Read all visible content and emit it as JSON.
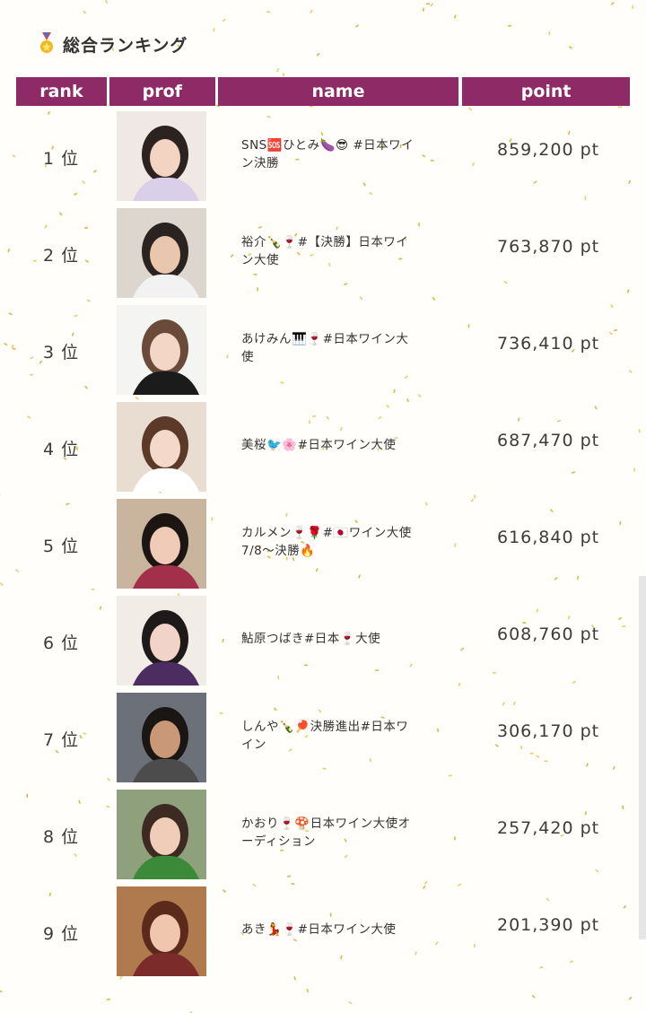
{
  "page": {
    "title": "総合ランキング",
    "title_icon": "medal-icon",
    "accent_color": "#8e2a66"
  },
  "table": {
    "headers": {
      "rank": "rank",
      "prof": "prof",
      "name": "name",
      "point": "point"
    },
    "rows": [
      {
        "rank": "1 位",
        "name_line1": "SNS🆘ひとみ🍆😎 #日本ワイ",
        "name_line2": "ン決勝",
        "point": "859,200 pt"
      },
      {
        "rank": "2 位",
        "name_line1": "裕介🍾🍷#【決勝】日本ワイ",
        "name_line2": "ン大使",
        "point": "763,870 pt"
      },
      {
        "rank": "3 位",
        "name_line1": "あけみん🎹🍷#日本ワイン大",
        "name_line2": "使",
        "point": "736,410 pt"
      },
      {
        "rank": "4 位",
        "name_line1": "美桜🐦🌸#日本ワイン大使",
        "name_line2": "",
        "point": "687,470 pt"
      },
      {
        "rank": "5 位",
        "name_line1": "カルメン🍷🌹#🇯🇵ワイン大使",
        "name_line2": "7/8～決勝🔥",
        "point": "616,840 pt"
      },
      {
        "rank": "6 位",
        "name_line1": "鮎原つばき#日本🍷大使",
        "name_line2": "",
        "point": "608,760 pt"
      },
      {
        "rank": "7 位",
        "name_line1": "しんや🍾🏓決勝進出#日本ワ",
        "name_line2": "イン",
        "point": "306,170 pt"
      },
      {
        "rank": "8 位",
        "name_line1": "かおり🍷🍄日本ワイン大使オ",
        "name_line2": "ーディション",
        "point": "257,420 pt"
      },
      {
        "rank": "9 位",
        "name_line1": "あき💃🍷#日本ワイン大使",
        "name_line2": "",
        "point": "201,390 pt"
      }
    ]
  }
}
